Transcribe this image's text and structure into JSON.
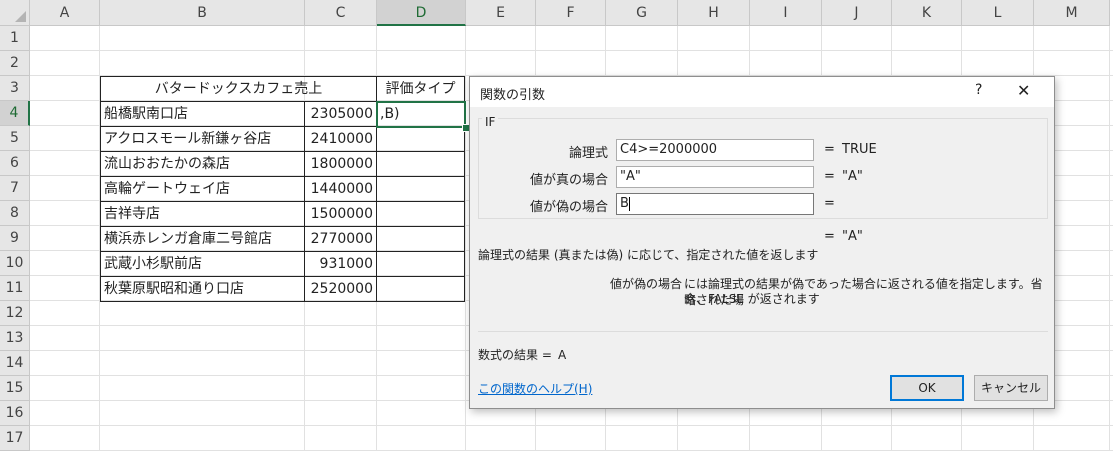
{
  "sheet": {
    "columns": [
      "A",
      "B",
      "C",
      "D",
      "E",
      "F",
      "G",
      "H",
      "I",
      "J",
      "K",
      "L",
      "M"
    ],
    "selected_column": "D",
    "rows": [
      "1",
      "2",
      "3",
      "4",
      "5",
      "6",
      "7",
      "8",
      "9",
      "10",
      "11",
      "12",
      "13",
      "14",
      "15",
      "16",
      "17"
    ],
    "selected_row": "4",
    "table_title": "バタードックスカフェ売上",
    "eval_header": "評価タイプ",
    "active_cell_content": ",B)",
    "stores": [
      {
        "name": "船橋駅南口店",
        "sales": "2305000"
      },
      {
        "name": "アクロスモール新鎌ヶ谷店",
        "sales": "2410000"
      },
      {
        "name": "流山おおたかの森店",
        "sales": "1800000"
      },
      {
        "name": "高輪ゲートウェイ店",
        "sales": "1440000"
      },
      {
        "name": "吉祥寺店",
        "sales": "1500000"
      },
      {
        "name": "横浜赤レンガ倉庫二号館店",
        "sales": "2770000"
      },
      {
        "name": "武蔵小杉駅前店",
        "sales": "931000"
      },
      {
        "name": "秋葉原駅昭和通り口店",
        "sales": "2520000"
      }
    ]
  },
  "dialog": {
    "title": "関数の引数",
    "help_glyph": "?",
    "close_glyph": "✕",
    "function_name": "IF",
    "args": [
      {
        "label": "論理式",
        "value": "C4>=2000000",
        "result": "TRUE"
      },
      {
        "label": "値が真の場合",
        "value": "\"A\"",
        "result": "\"A\""
      },
      {
        "label": "値が偽の場合",
        "value": "B",
        "result": ""
      }
    ],
    "eq": "=",
    "arg_button_glyph": "⬆",
    "overall_result": "\"A\"",
    "description": "論理式の結果 (真または偽) に応じて、指定された値を返します",
    "param_name": "値が偽の場合",
    "param_desc_1": "には論理式の結果が偽であった場合に返される値を指定します。省略された場",
    "param_desc_2": "合、FALSE が返されます",
    "formula_result_label": "数式の結果 =",
    "formula_result_value": "A",
    "help_link": "この関数のヘルプ(H)",
    "ok_label": "OK",
    "cancel_label": "キャンセル"
  }
}
